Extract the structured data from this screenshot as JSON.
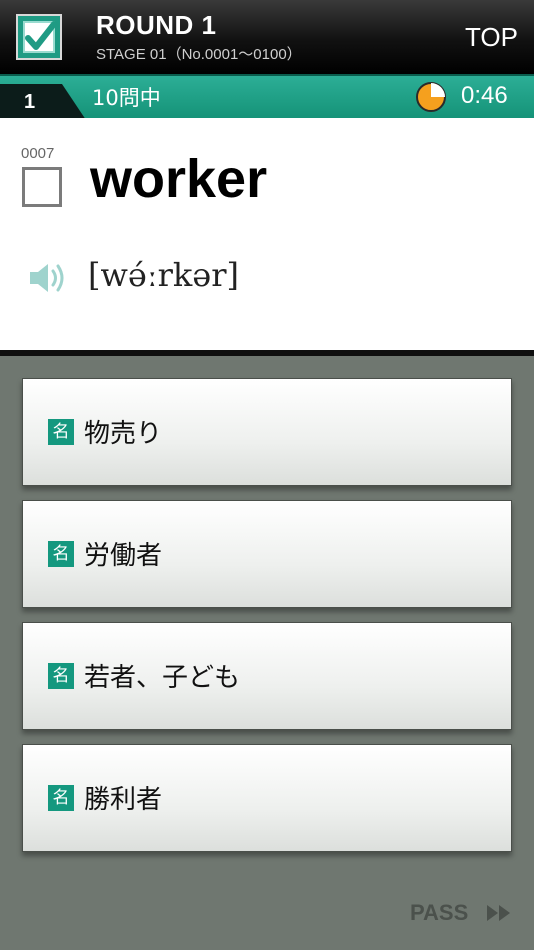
{
  "header": {
    "round_title": "ROUND 1",
    "stage_label": "STAGE 01（No.0001～0100）",
    "top_label": "TOP"
  },
  "status": {
    "question_number": "1",
    "question_count": "10問中",
    "timer": "0:46",
    "timer_elapsed_fraction": 0.25,
    "timer_color": "#f5a01e"
  },
  "word": {
    "id": "0007",
    "text": "worker",
    "pronunciation": "[wə́ːrkər]"
  },
  "answers": [
    {
      "pos": "名",
      "text": "物売り"
    },
    {
      "pos": "名",
      "text": "労働者"
    },
    {
      "pos": "名",
      "text": "若者、子ども"
    },
    {
      "pos": "名",
      "text": "勝利者"
    }
  ],
  "pass_label": "PASS",
  "colors": {
    "accent": "#1a9e85",
    "background": "#6f7770",
    "header": "#111111"
  }
}
